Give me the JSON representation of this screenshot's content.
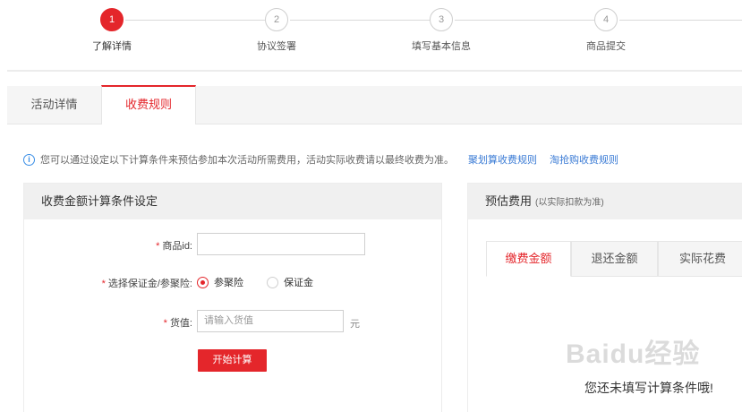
{
  "steps": [
    {
      "number": "1",
      "label": "了解详情",
      "active": true
    },
    {
      "number": "2",
      "label": "协议签署",
      "active": false
    },
    {
      "number": "3",
      "label": "填写基本信息",
      "active": false
    },
    {
      "number": "4",
      "label": "商品提交",
      "active": false
    }
  ],
  "tabs": [
    {
      "label": "活动详情",
      "active": false
    },
    {
      "label": "收费规则",
      "active": true
    }
  ],
  "notice": {
    "text": "您可以通过设定以下计算条件来预估参加本次活动所需费用，活动实际收费请以最终收费为准。",
    "link1": "聚划算收费规则",
    "link2": "淘抢购收费规则"
  },
  "left_panel": {
    "title": "收费金额计算条件设定",
    "product_id_label": "商品id:",
    "product_id_value": "",
    "type_label": "选择保证金/参聚险:",
    "option1": "参聚险",
    "option2": "保证金",
    "selected": "参聚险",
    "value_label": "货值:",
    "value_placeholder": "请输入货值",
    "unit": "元",
    "calc_button": "开始计算",
    "required_mark": "*"
  },
  "right_panel": {
    "title": "预估费用",
    "subtitle": "(以实际扣款为准)",
    "subtabs": [
      {
        "label": "缴费金额",
        "active": true
      },
      {
        "label": "退还金额",
        "active": false
      },
      {
        "label": "实际花费",
        "active": false
      }
    ],
    "empty_text": "您还未填写计算条件哦!"
  },
  "watermark": "Baidu经验",
  "colors": {
    "accent": "#e4262b",
    "link": "#3a7bd5"
  }
}
